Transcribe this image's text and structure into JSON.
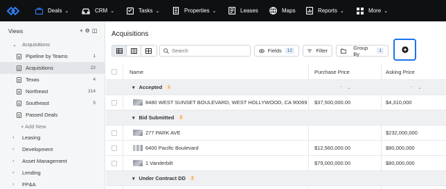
{
  "nav": {
    "items": [
      {
        "label": "Deals",
        "icon": "briefcase-icon",
        "dropdown": true,
        "active": true
      },
      {
        "label": "CRM",
        "icon": "car-icon",
        "dropdown": true
      },
      {
        "label": "Tasks",
        "icon": "clipboard-icon",
        "dropdown": true
      },
      {
        "label": "Properties",
        "icon": "building-icon",
        "dropdown": true
      },
      {
        "label": "Leases",
        "icon": "lease-icon",
        "dropdown": false
      },
      {
        "label": "Maps",
        "icon": "globe-icon",
        "dropdown": false
      },
      {
        "label": "Reports",
        "icon": "report-icon",
        "dropdown": true
      },
      {
        "label": "More",
        "icon": "grid-icon",
        "dropdown": true
      }
    ]
  },
  "sidebar": {
    "heading": "Views",
    "tools": [
      "+",
      "⚙",
      "◫"
    ],
    "acquisitions_folder": "Acquisitions",
    "views": [
      {
        "label": "Pipeline by Teams",
        "count": "1"
      },
      {
        "label": "Acquisitions",
        "count": "22",
        "selected": true
      },
      {
        "label": "Texas",
        "count": "4"
      },
      {
        "label": "Northeast",
        "count": "214"
      },
      {
        "label": "Southeast",
        "count": "5"
      },
      {
        "label": "Passed Deals",
        "count": ""
      }
    ],
    "add_new": "+ Add New",
    "folders": [
      "Leasing",
      "Development",
      "Asset Management",
      "Lending",
      "FP&A"
    ]
  },
  "main": {
    "title": "Acquisitions",
    "search_placeholder": "Search",
    "fields_label": "Fields",
    "fields_count": "12",
    "filter_label": "Filter",
    "groupby_label": "Group By",
    "groupby_count": "1"
  },
  "table": {
    "headers": {
      "name": "Name",
      "purchase": "Purchase Price",
      "asking": "Asking Price"
    },
    "groups": [
      {
        "label": "Accepted",
        "count": "1",
        "rows": [
          {
            "name": "8480 WEST SUNSET BOULEVARD, WEST HOLLYWOOD, CA 90069",
            "purchase": "$37,500,000.00",
            "asking": "$4,310,000"
          }
        ]
      },
      {
        "label": "Bid Submitted",
        "count": "3",
        "rows": [
          {
            "name": "277 PARK AVE",
            "purchase": "",
            "asking": "$232,000,000"
          },
          {
            "name": "6400 Pacific Boulevard",
            "purchase": "$12,560,000.00",
            "asking": "$80,000,000"
          },
          {
            "name": "1 Vanderbilt",
            "purchase": "$79,000,000.00",
            "asking": "$80,000,000"
          }
        ]
      },
      {
        "label": "Under Contract DD",
        "count": "2",
        "rows": []
      }
    ],
    "group_dash": "-"
  }
}
